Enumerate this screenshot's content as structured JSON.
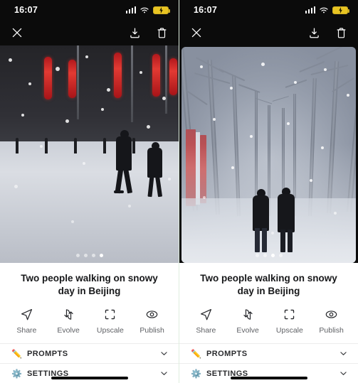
{
  "status_bar": {
    "time": "16:07",
    "signal_icon": "signal-bars-icon",
    "wifi_icon": "wifi-icon",
    "battery_icon": "battery-charging-icon",
    "battery_color": "#e9c522"
  },
  "toolbar": {
    "close_label": "close-icon",
    "download_label": "download-icon",
    "delete_label": "delete-icon"
  },
  "gallery": {
    "left": {
      "alt": "Two people walking on a snowy street with red lanterns in Beijing",
      "dots_total": 4,
      "dots_active": 4
    },
    "right": {
      "alt": "Two people walking away on a foggy snowy tree-lined path",
      "dots_total": 4,
      "dots_active": 3
    }
  },
  "caption": {
    "title": "Two people walking on snowy day in Beijing"
  },
  "actions": [
    {
      "label": "Share",
      "icon": "send-icon"
    },
    {
      "label": "Evolve",
      "icon": "swap-arrows-icon"
    },
    {
      "label": "Upscale",
      "icon": "expand-corners-icon"
    },
    {
      "label": "Publish",
      "icon": "eye-icon"
    }
  ],
  "sections": [
    {
      "title": "PROMPTS",
      "emoji": "✏️",
      "icon": "pencil-icon",
      "chevron": "chevron-down-icon",
      "expanded": false
    },
    {
      "title": "SETTINGS",
      "emoji": "⚙️",
      "icon": "gear-icon",
      "chevron": "chevron-down-icon",
      "expanded": false
    }
  ],
  "colors": {
    "chrome": "#0b0b0b",
    "accent_red": "#d23a36",
    "divider": "#dfeedf"
  }
}
